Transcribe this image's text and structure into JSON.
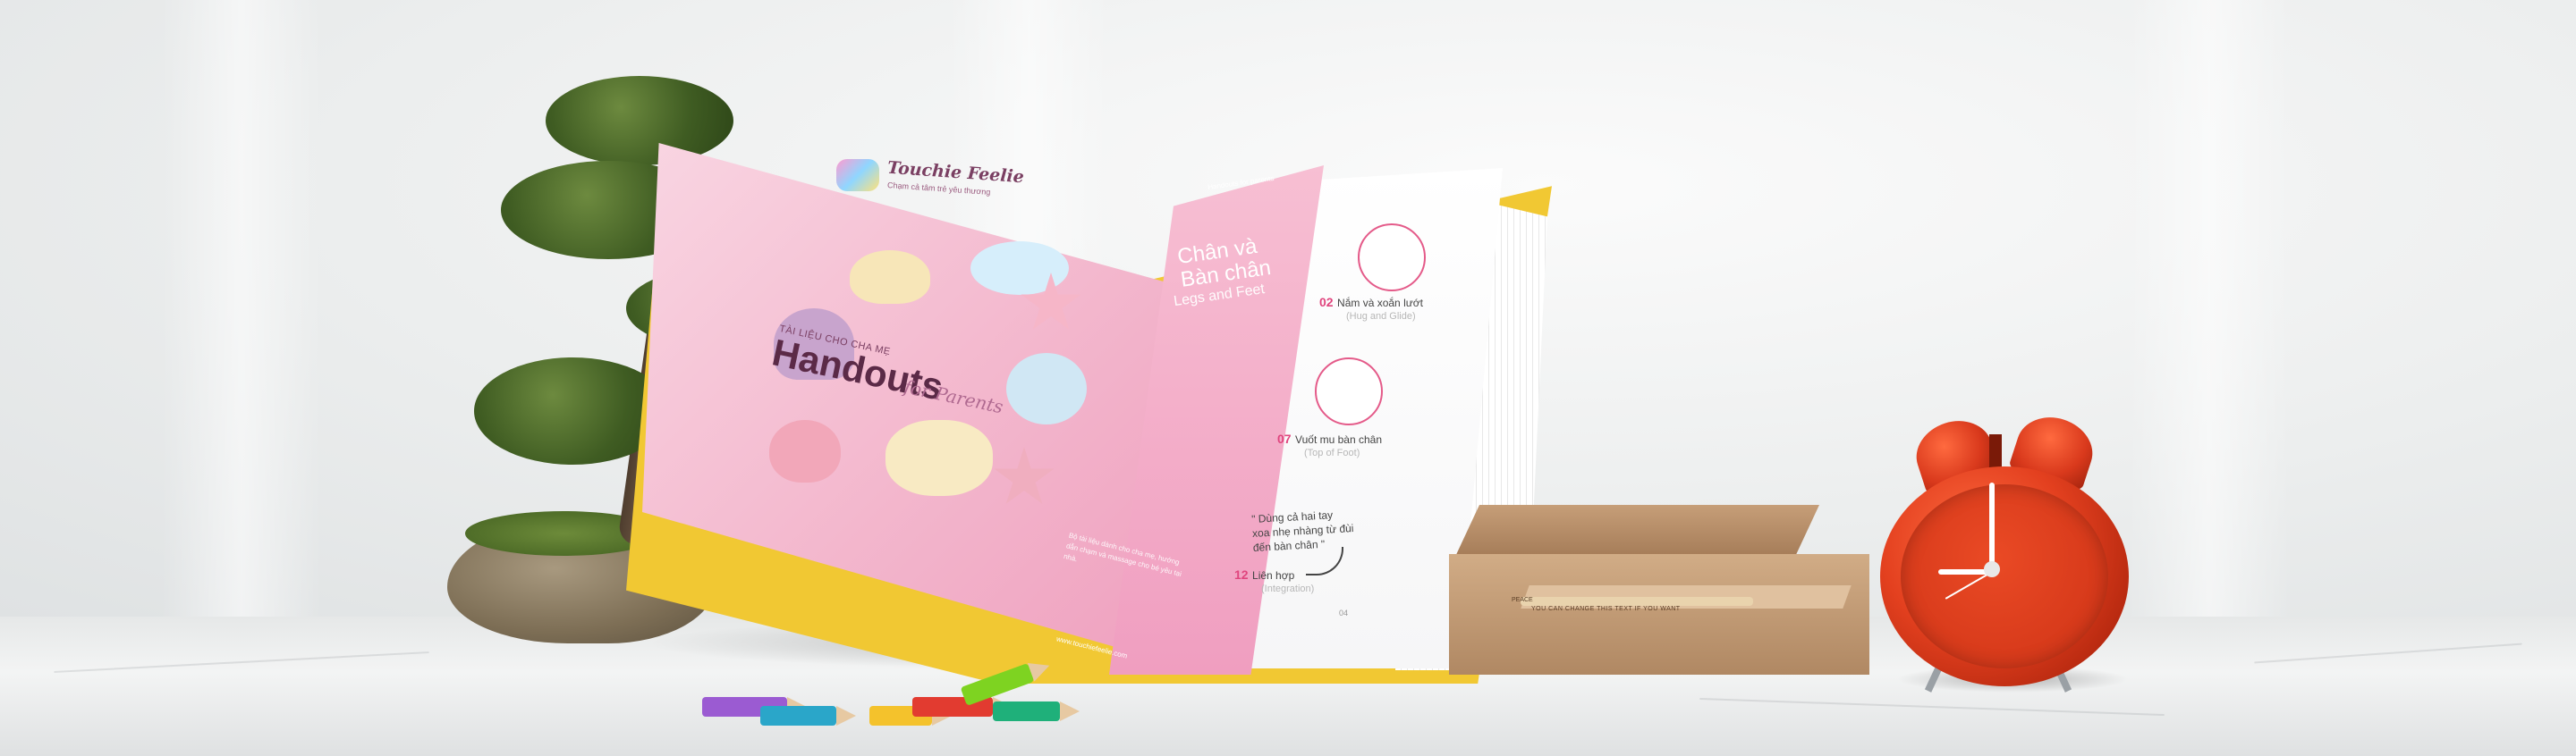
{
  "book": {
    "brand_name": "Touchie Feelie",
    "brand_tagline": "Chạm cả tâm trẻ yêu thương",
    "cover_kicker": "TÀI LIỆU CHO CHA MẸ",
    "cover_title": "Handouts",
    "cover_script": "for Parents",
    "left_footer": "Bộ tài liệu dành cho cha mẹ, hướng dẫn chạm và massage cho bé yêu tại nhà.",
    "left_url": "www.touchiefeelie.com",
    "section_kicker": "Handouts for parents",
    "section_title_line1": "Chân và",
    "section_title_line2": "Bàn chân",
    "section_subtitle": "Legs and Feet",
    "steps": [
      {
        "num": "02",
        "label": "Nắm và xoắn lướt",
        "en": "(Hug and Glide)"
      },
      {
        "num": "07",
        "label": "Vuốt mu bàn chân",
        "en": "(Top of Foot)"
      },
      {
        "num": "12",
        "label": "Liên hợp",
        "en": "(Integration)"
      }
    ],
    "quote_line1": "\" Dùng cả hai tay",
    "quote_line2": "xoa nhẹ nhàng từ đùi",
    "quote_line3": "đến bàn chân \"",
    "page_number": "04"
  },
  "props": {
    "box_label": "YOU CAN CHANGE THIS TEXT IF YOU WANT",
    "box_stamp": "PEACE"
  },
  "colors": {
    "accent_pink": "#e0457e",
    "cover_yellow": "#f1c833",
    "clock_red": "#d9391c"
  }
}
